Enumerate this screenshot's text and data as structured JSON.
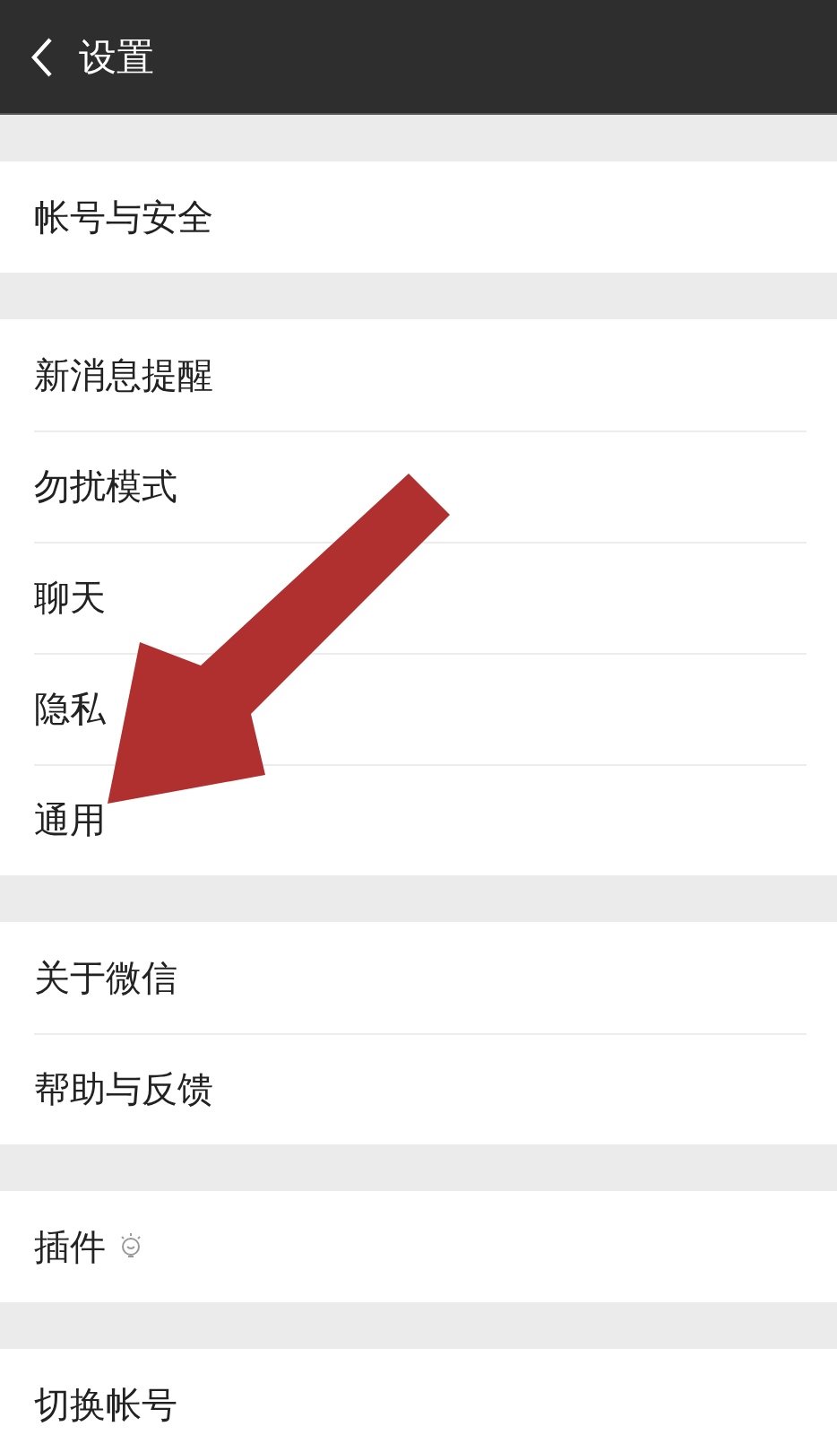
{
  "header": {
    "title": "设置"
  },
  "groups": [
    {
      "items": [
        {
          "label": "帐号与安全",
          "kind": "plain"
        }
      ]
    },
    {
      "items": [
        {
          "label": "新消息提醒",
          "kind": "plain"
        },
        {
          "label": "勿扰模式",
          "kind": "plain"
        },
        {
          "label": "聊天",
          "kind": "plain"
        },
        {
          "label": "隐私",
          "kind": "plain"
        },
        {
          "label": "通用",
          "kind": "plain"
        }
      ]
    },
    {
      "items": [
        {
          "label": "关于微信",
          "kind": "plain"
        },
        {
          "label": "帮助与反馈",
          "kind": "plain"
        }
      ]
    },
    {
      "items": [
        {
          "label": "插件",
          "kind": "with_icon"
        }
      ]
    },
    {
      "items": [
        {
          "label": "切换帐号",
          "kind": "plain"
        }
      ]
    }
  ],
  "annotation": {
    "kind": "arrow"
  }
}
